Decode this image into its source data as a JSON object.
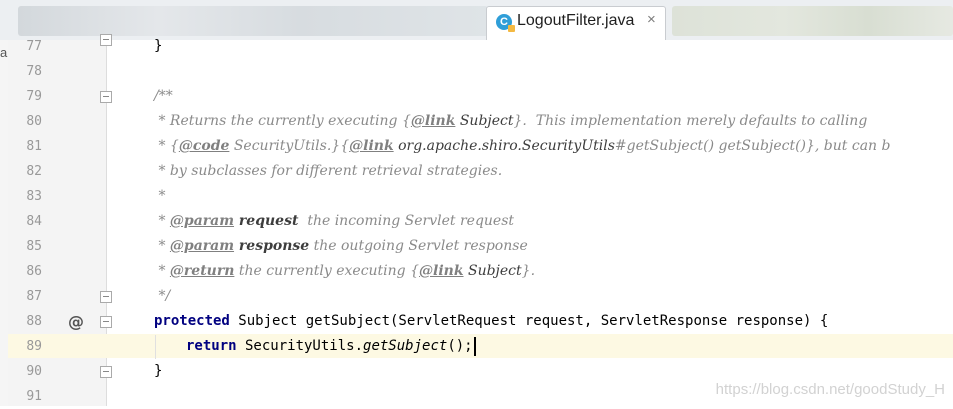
{
  "tab": {
    "icon_letter": "C",
    "label": "LogoutFilter.java",
    "close": "×"
  },
  "sidebar_letter": "a",
  "watermark": "https://blog.csdn.net/goodStudy_H",
  "code": {
    "l77": {
      "num": "77",
      "text": "}"
    },
    "l78": {
      "num": "78"
    },
    "l79": {
      "num": "79",
      "text": "/**"
    },
    "l80": {
      "num": "80",
      "a": " * Returns the currently executing ",
      "b": "{",
      "tag": "@link",
      "ref": " Subject",
      "c": "}.  This implementation merely defaults to calling"
    },
    "l81": {
      "num": "81",
      "a": " * ",
      "b": "{",
      "tag1": "@code",
      "c": " SecurityUtils.}",
      "d": "{",
      "tag2": "@link",
      "ref": " org.apache.shiro.SecurityUtils",
      "e": "#getSubject() getSubject()}, but can b"
    },
    "l82": {
      "num": "82",
      "text": " * by subclasses for different retrieval strategies."
    },
    "l83": {
      "num": "83",
      "text": " *"
    },
    "l84": {
      "num": "84",
      "a": " * ",
      "tag": "@param",
      "name": " request",
      "c": "  the incoming Servlet request"
    },
    "l85": {
      "num": "85",
      "a": " * ",
      "tag": "@param",
      "name": " response",
      "c": " the outgoing Servlet response"
    },
    "l86": {
      "num": "86",
      "a": " * ",
      "tag": "@return",
      "b": " the currently executing ",
      "c": "{",
      "tag2": "@link",
      "ref": " Subject",
      "d": "}."
    },
    "l87": {
      "num": "87",
      "text": " */"
    },
    "l88": {
      "num": "88",
      "marker": "@",
      "kw": "protected",
      "rest": " Subject getSubject(ServletRequest request, ServletResponse response) {"
    },
    "l89": {
      "num": "89",
      "kw": "return",
      "a": " SecurityUtils.",
      "call": "getSubject",
      "b": "();"
    },
    "l90": {
      "num": "90",
      "text": "}"
    },
    "l91": {
      "num": "91"
    }
  }
}
